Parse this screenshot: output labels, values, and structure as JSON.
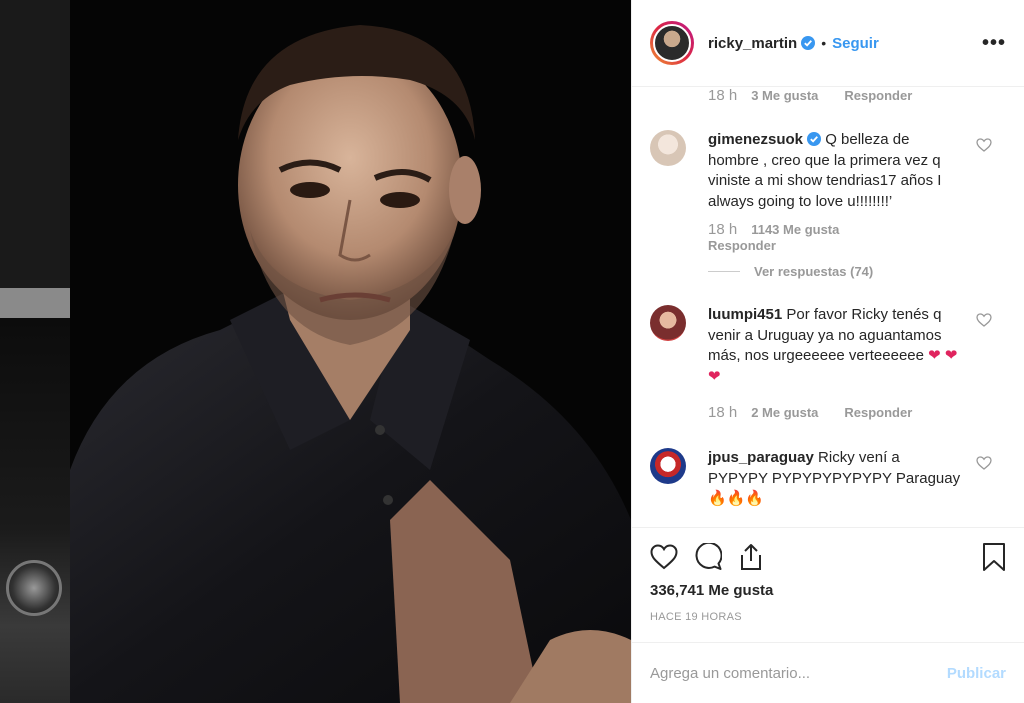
{
  "post": {
    "username": "ricky_martin",
    "separator": "•",
    "follow_label": "Seguir",
    "more_label": "•••"
  },
  "comments": [
    {
      "type": "meta",
      "time": "18 h",
      "likes": "3 Me gusta",
      "reply": "Responder"
    },
    {
      "username": "gimenezsuok",
      "verified": true,
      "text": "Q belleza de hombre , creo que la primera vez q viniste a mi show tendrias17 años I always going to love u!!!!!!!!’",
      "time": "18 h",
      "likes": "1143 Me gusta",
      "reply": "Responder",
      "view_replies": "Ver respuestas (74)"
    },
    {
      "username": "luumpi451",
      "text": "Por favor Ricky tenés q venir a Uruguay ya no aguantamos más, nos urgeeeeee verteeeeee",
      "emoji": "❤ ❤ ❤",
      "time": "18 h",
      "likes": "2 Me gusta",
      "reply": "Responder"
    },
    {
      "username": "jpus_paraguay",
      "text": "Ricky vení a PYPYPY PYPYPYPYPYPY Paraguay",
      "emoji": "🔥🔥🔥"
    }
  ],
  "actions": {
    "like_count": "336,741 Me gusta",
    "posted": "HACE 19 HORAS"
  },
  "add_comment": {
    "placeholder": "Agrega un comentario...",
    "publish_label": "Publicar"
  },
  "colors": {
    "accent": "#3897f0",
    "verified": "#3897f0",
    "publish_disabled": "#b3dbff",
    "heart_red": "#e0245e"
  },
  "icons": [
    "verified-badge-icon",
    "heart-icon",
    "comment-icon",
    "share-icon",
    "bookmark-icon",
    "more-options-icon"
  ]
}
